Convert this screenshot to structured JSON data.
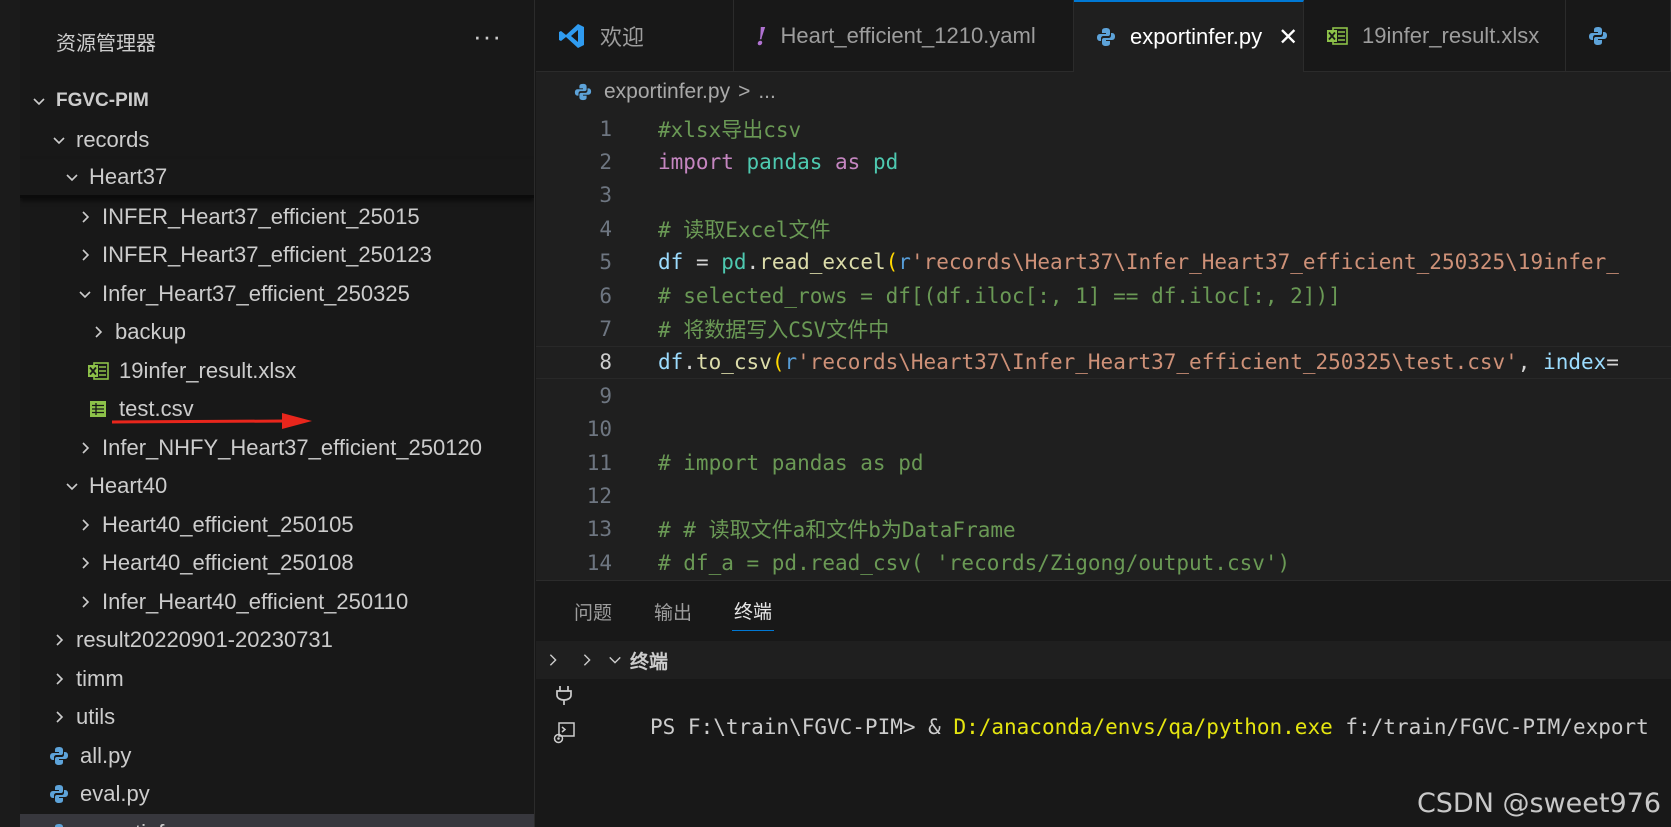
{
  "sidebar": {
    "title": "资源管理器",
    "more": "···",
    "root": "FGVC-PIM",
    "items": [
      {
        "label": "records",
        "depth": 1,
        "kind": "folder-open"
      },
      {
        "label": "Heart37",
        "depth": 2,
        "kind": "folder-open"
      },
      {
        "label": "INFER_Heart37_efficient_25015",
        "depth": 3,
        "kind": "folder-closed"
      },
      {
        "label": "INFER_Heart37_efficient_250123",
        "depth": 3,
        "kind": "folder-closed"
      },
      {
        "label": "Infer_Heart37_efficient_250325",
        "depth": 3,
        "kind": "folder-open"
      },
      {
        "label": "backup",
        "depth": 4,
        "kind": "folder-closed"
      },
      {
        "label": "19infer_result.xlsx",
        "depth": 4,
        "kind": "excel-file"
      },
      {
        "label": "test.csv",
        "depth": 4,
        "kind": "csv-file"
      },
      {
        "label": "Infer_NHFY_Heart37_efficient_250120",
        "depth": 3,
        "kind": "folder-closed"
      },
      {
        "label": "Heart40",
        "depth": 2,
        "kind": "folder-open"
      },
      {
        "label": "Heart40_efficient_250105",
        "depth": 3,
        "kind": "folder-closed"
      },
      {
        "label": "Heart40_efficient_250108",
        "depth": 3,
        "kind": "folder-closed"
      },
      {
        "label": "Infer_Heart40_efficient_250110",
        "depth": 3,
        "kind": "folder-closed"
      },
      {
        "label": "result20220901-20230731",
        "depth": 1,
        "kind": "folder-closed"
      },
      {
        "label": "timm",
        "depth": 1,
        "kind": "folder-closed"
      },
      {
        "label": "utils",
        "depth": 1,
        "kind": "folder-closed"
      },
      {
        "label": "all.py",
        "depth": 1,
        "kind": "python-file"
      },
      {
        "label": "eval.py",
        "depth": 1,
        "kind": "python-file"
      },
      {
        "label": "exportinfer.py",
        "depth": 1,
        "kind": "python-file"
      }
    ]
  },
  "tabs": [
    {
      "label": "欢迎",
      "icon": "vscode-logo-icon"
    },
    {
      "label": "Heart_efficient_1210.yaml",
      "icon": "yaml-exclamation-icon"
    },
    {
      "label": "exportinfer.py",
      "icon": "python-icon",
      "active": true,
      "close": "✕"
    },
    {
      "label": "19infer_result.xlsx",
      "icon": "excel-icon"
    }
  ],
  "breadcrumb": {
    "file": "exportinfer.py",
    "sep": ">",
    "rest": "..."
  },
  "code": {
    "current_line": 8,
    "lines": [
      {
        "n": "1",
        "tokens": [
          [
            "com",
            "#xlsx导出csv"
          ]
        ]
      },
      {
        "n": "2",
        "tokens": [
          [
            "kw",
            "import"
          ],
          [
            "op",
            " "
          ],
          [
            "mod",
            "pandas"
          ],
          [
            "op",
            " "
          ],
          [
            "kw",
            "as"
          ],
          [
            "op",
            " "
          ],
          [
            "mod",
            "pd"
          ]
        ]
      },
      {
        "n": "3",
        "tokens": []
      },
      {
        "n": "4",
        "tokens": [
          [
            "com",
            "# 读取Excel文件"
          ]
        ]
      },
      {
        "n": "5",
        "tokens": [
          [
            "var",
            "df"
          ],
          [
            "op",
            " = "
          ],
          [
            "mod",
            "pd"
          ],
          [
            "op",
            "."
          ],
          [
            "fn",
            "read_excel"
          ],
          [
            "br",
            "("
          ],
          [
            "pfx",
            "r"
          ],
          [
            "str",
            "'records\\Heart37\\Infer_Heart37_efficient_250325\\19infer_"
          ]
        ]
      },
      {
        "n": "6",
        "tokens": [
          [
            "com",
            "# selected_rows = df[(df.iloc[:, 1] == df.iloc[:, 2])]"
          ]
        ]
      },
      {
        "n": "7",
        "tokens": [
          [
            "com",
            "# 将数据写入CSV文件中"
          ]
        ]
      },
      {
        "n": "8",
        "tokens": [
          [
            "var",
            "df"
          ],
          [
            "op",
            "."
          ],
          [
            "fn",
            "to_csv"
          ],
          [
            "br",
            "("
          ],
          [
            "pfx",
            "r"
          ],
          [
            "str",
            "'records\\Heart37\\Infer_Heart37_efficient_250325\\test.csv'"
          ],
          [
            "op",
            ", "
          ],
          [
            "var",
            "index"
          ],
          [
            "op",
            "="
          ]
        ]
      },
      {
        "n": "9",
        "tokens": []
      },
      {
        "n": "10",
        "tokens": []
      },
      {
        "n": "11",
        "tokens": [
          [
            "com",
            "# import pandas as pd"
          ]
        ]
      },
      {
        "n": "12",
        "tokens": []
      },
      {
        "n": "13",
        "tokens": [
          [
            "com",
            "# # 读取文件a和文件b为DataFrame"
          ]
        ]
      },
      {
        "n": "14",
        "tokens": [
          [
            "com",
            "# df_a = pd.read_csv( 'records/Zigong/output.csv')"
          ]
        ]
      }
    ]
  },
  "panel": {
    "tabs": [
      "问题",
      "输出",
      "终端"
    ],
    "active_tab": "终端",
    "terminal_title": "终端",
    "prompt": "PS F:\\train\\FGVC-PIM> & ",
    "exe": "D:/anaconda/envs/qa/python.exe",
    "args": " f:/train/FGVC-PIM/export"
  },
  "watermark": "CSDN @sweet976",
  "colors": {
    "accent": "#0078d4",
    "arrow": "#e8261c"
  }
}
